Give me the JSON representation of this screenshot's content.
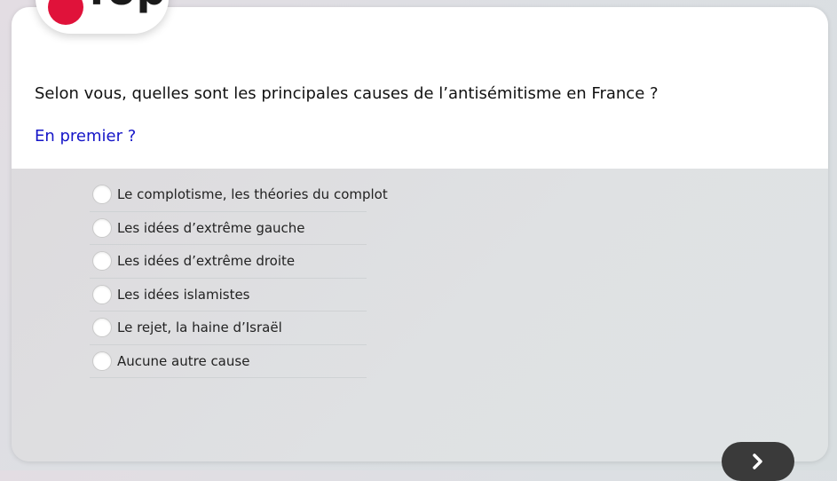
{
  "logo": {
    "text": "fop"
  },
  "question": {
    "text": "Selon vous, quelles sont les principales causes de l’antisémitisme en France ?",
    "sub": "En premier ?"
  },
  "options": [
    {
      "label": "Le complotisme, les théories du complot"
    },
    {
      "label": "Les idées d’extrême gauche"
    },
    {
      "label": "Les idées d’extrême droite"
    },
    {
      "label": "Les idées islamistes"
    },
    {
      "label": "Le rejet, la haine d’Israël"
    },
    {
      "label": "Aucune autre cause"
    }
  ],
  "navigation": {
    "next_icon": "chevron-right-icon"
  },
  "colors": {
    "accent_blue": "#1616c8",
    "brand_red": "#e0123a",
    "button_dark": "#3a3a3a"
  }
}
